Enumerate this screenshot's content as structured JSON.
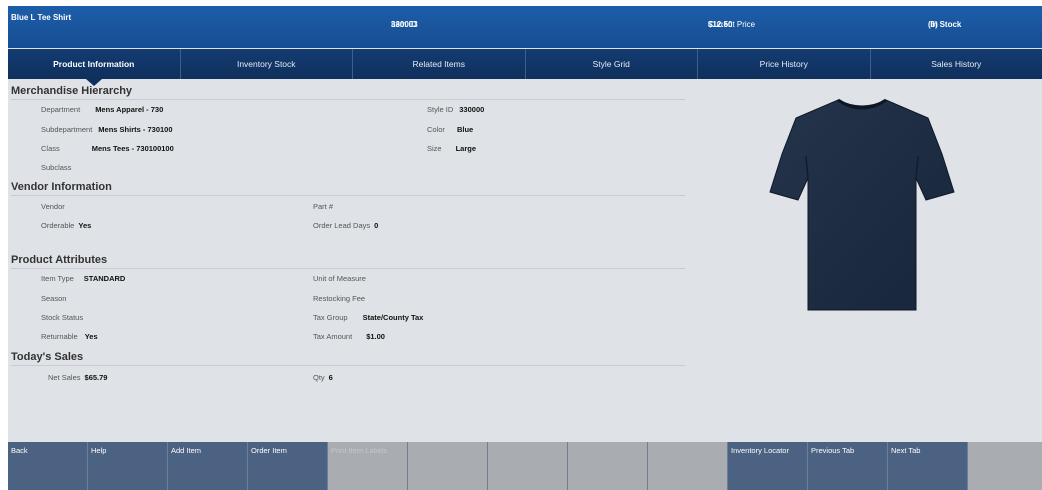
{
  "header": {
    "title": "Blue L Tee Shirt",
    "item_id_label": "Item ID",
    "item_id": "330003",
    "price_label": "Current Price",
    "price": "$12.50",
    "stock_count": "(6)",
    "stock_label": "In Stock"
  },
  "tabs": [
    "Product Information",
    "Inventory Stock",
    "Related Items",
    "Style Grid",
    "Price History",
    "Sales History"
  ],
  "merch": {
    "heading": "Merchandise Hierarchy",
    "department_label": "Department",
    "department": "Mens Apparel - 730",
    "subdepartment_label": "Subdepartment",
    "subdepartment": "Mens Shirts - 730100",
    "class_label": "Class",
    "class": "Mens Tees - 730100100",
    "subclass_label": "Subclass",
    "style_id_label": "Style ID",
    "style_id": "330000",
    "color_label": "Color",
    "color": "Blue",
    "size_label": "Size",
    "size": "Large"
  },
  "vendor": {
    "heading": "Vendor Information",
    "vendor_label": "Vendor",
    "orderable_label": "Orderable",
    "orderable": "Yes",
    "part_label": "Part #",
    "lead_label": "Order Lead Days",
    "lead": "0"
  },
  "attributes": {
    "heading": "Product Attributes",
    "item_type_label": "Item Type",
    "item_type": "STANDARD",
    "season_label": "Season",
    "stock_status_label": "Stock Status",
    "returnable_label": "Returnable",
    "returnable": "Yes",
    "uom_label": "Unit of Measure",
    "restock_label": "Restocking Fee",
    "tax_group_label": "Tax Group",
    "tax_group": "State/County Tax",
    "tax_amount_label": "Tax Amount",
    "tax_amount": "$1.00"
  },
  "sales": {
    "heading": "Today's Sales",
    "net_label": "Net Sales",
    "net": "$65.79",
    "qty_label": "Qty",
    "qty": "6"
  },
  "toolbar": {
    "back": "Back",
    "help": "Help",
    "add_item": "Add Item",
    "order_item": "Order Item",
    "print_item_labels": "Print Item Labels",
    "inventory_locator": "Inventory Locator",
    "previous_tab": "Previous Tab",
    "next_tab": "Next Tab"
  },
  "colors": {
    "header": "#1d5ea9",
    "tabs": "#133c72",
    "button": "#4c6282",
    "disabled": "#a9adb2",
    "shirt": "#1c2a3e"
  },
  "image": {
    "icon": "tshirt-image"
  }
}
